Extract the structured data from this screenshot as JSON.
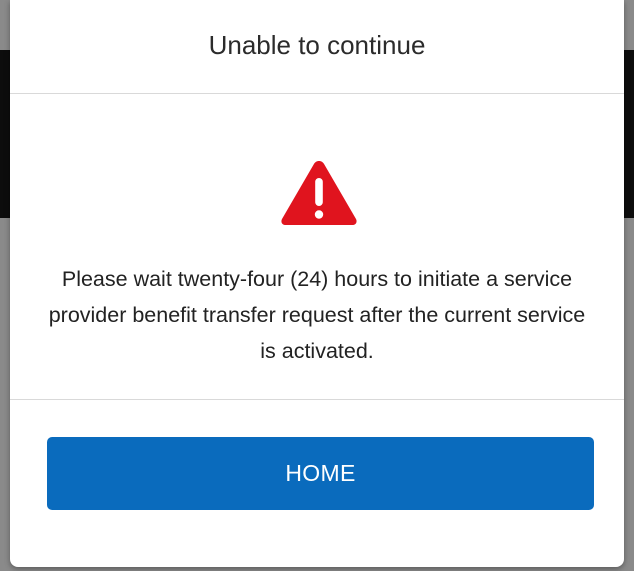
{
  "dialog": {
    "title": "Unable to continue",
    "icon": "warning-triangle-icon",
    "icon_color": "#e0141e",
    "message": "Please wait twenty-four (24) hours to initiate a service provider benefit transfer request after the current service is activated.",
    "primary_button_label": "HOME",
    "primary_button_color": "#0a6bbd"
  }
}
